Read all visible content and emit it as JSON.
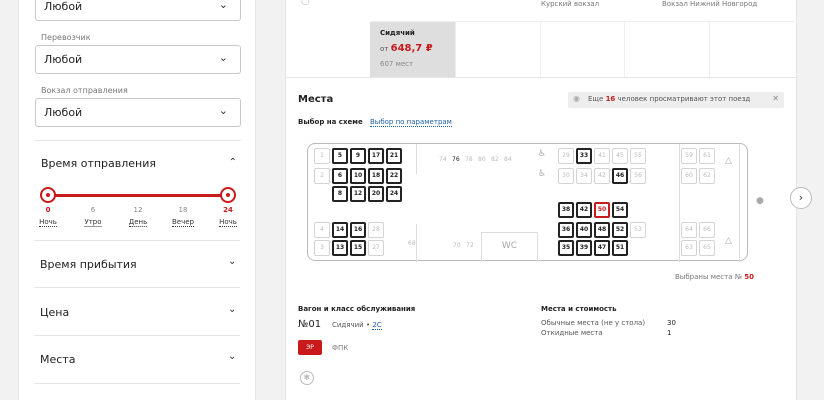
{
  "filters": {
    "top_select": {
      "value": "Любой"
    },
    "carrier": {
      "label": "Перевозчик",
      "value": "Любой"
    },
    "station": {
      "label": "Вокзал отправления",
      "value": "Любой"
    },
    "departure_time": {
      "title": "Время отправления",
      "range": {
        "from": 0,
        "to": 24
      },
      "ticks": [
        "0",
        "6",
        "12",
        "18",
        "24"
      ],
      "periods": [
        "Ночь",
        "Утро",
        "День",
        "Вечер",
        "Ночь"
      ]
    },
    "sections": [
      "Время прибытия",
      "Цена",
      "Места"
    ]
  },
  "train": {
    "from_station": "Курский вокзал",
    "to_station": "Вокзал Нижний Новгород"
  },
  "class_card": {
    "name": "Сидячий",
    "price_prefix": "от",
    "price": "648,7 ₽",
    "seats": "607 мест"
  },
  "places": {
    "title": "Места",
    "viewers_prefix": "Еще",
    "viewers_count": "16",
    "viewers_suffix": "человек просматривают этот поезд",
    "tab_scheme": "Выбор на схеме",
    "tab_params": "Выбор по параметрам",
    "wc_label": "WC",
    "selected_prefix": "Выбраны места №",
    "selected_seat": "50"
  },
  "seats_top_left": [
    {
      "n": "1",
      "a": false
    },
    {
      "n": "5",
      "a": true
    },
    {
      "n": "9",
      "a": true
    },
    {
      "n": "17",
      "a": true
    },
    {
      "n": "21",
      "a": true
    },
    {
      "n": "2",
      "a": false
    },
    {
      "n": "6",
      "a": true
    },
    {
      "n": "10",
      "a": true
    },
    {
      "n": "18",
      "a": true
    },
    {
      "n": "22",
      "a": true
    },
    {
      "n": "8",
      "a": true
    },
    {
      "n": "12",
      "a": true
    },
    {
      "n": "20",
      "a": true
    },
    {
      "n": "24",
      "a": true
    }
  ],
  "seats_bottom_left": [
    {
      "n": "4",
      "a": false
    },
    {
      "n": "14",
      "a": true
    },
    {
      "n": "16",
      "a": true
    },
    {
      "n": "28",
      "a": false
    },
    {
      "n": "3",
      "a": false
    },
    {
      "n": "13",
      "a": true
    },
    {
      "n": "15",
      "a": true
    },
    {
      "n": "27",
      "a": false
    }
  ],
  "middle_row": [
    {
      "n": "74",
      "a": false
    },
    {
      "n": "76",
      "a": true
    },
    {
      "n": "78",
      "a": false
    },
    {
      "n": "80",
      "a": false
    },
    {
      "n": "82",
      "a": false
    },
    {
      "n": "84",
      "a": false
    }
  ],
  "lower_mid": [
    {
      "n": "68",
      "a": false
    },
    {
      "n": "70",
      "a": false
    },
    {
      "n": "72",
      "a": false
    }
  ],
  "seats_right": [
    {
      "n": "29",
      "a": false
    },
    {
      "n": "33",
      "a": true
    },
    {
      "n": "41",
      "a": false
    },
    {
      "n": "45",
      "a": false
    },
    {
      "n": "30",
      "a": false
    },
    {
      "n": "34",
      "a": false
    },
    {
      "n": "42",
      "a": false
    },
    {
      "n": "46",
      "a": true
    },
    {
      "n": "38",
      "a": true
    },
    {
      "n": "42",
      "a": true
    },
    {
      "n": "50",
      "a": "sel"
    },
    {
      "n": "54",
      "a": true
    },
    {
      "n": "36",
      "a": true
    },
    {
      "n": "40",
      "a": true
    },
    {
      "n": "48",
      "a": true
    },
    {
      "n": "52",
      "a": true
    },
    {
      "n": "35",
      "a": true
    },
    {
      "n": "39",
      "a": true
    },
    {
      "n": "47",
      "a": true
    },
    {
      "n": "51",
      "a": true
    },
    {
      "n": "55",
      "a": false
    },
    {
      "n": "56",
      "a": false
    },
    {
      "n": "53",
      "a": false
    }
  ],
  "seats_far_right": [
    {
      "n": "59",
      "a": false
    },
    {
      "n": "61",
      "a": false
    },
    {
      "n": "60",
      "a": false
    },
    {
      "n": "62",
      "a": false
    },
    {
      "n": "64",
      "a": false
    },
    {
      "n": "66",
      "a": false
    },
    {
      "n": "63",
      "a": false
    },
    {
      "n": "65",
      "a": false
    }
  ],
  "car_info": {
    "title": "Вагон и класс обслуживания",
    "number": "№01",
    "class_name": "Сидячий",
    "class_code": "2С",
    "badge": "ЭР",
    "carrier": "ФПК"
  },
  "prices": {
    "title": "Места и стоимость",
    "rows": [
      {
        "label": "Обычные места (не у стола)",
        "value": "30"
      },
      {
        "label": "Откидные места",
        "value": "1"
      }
    ]
  }
}
